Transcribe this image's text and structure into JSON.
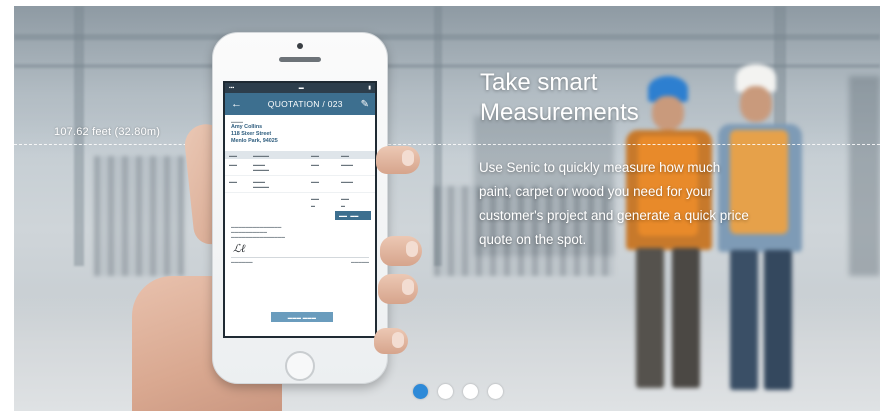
{
  "slide": {
    "measurement_label": "107.62 feet (32.80m)",
    "headline_line1": "Take smart",
    "headline_line2": "Measurements",
    "body_line1": "Use Senic to quickly measure how much",
    "body_line2": "paint, carpet or wood you need for your",
    "body_line3": "customer's project and generate a quick price",
    "body_line4": "quote on the spot."
  },
  "phone": {
    "appbar": {
      "back_icon": "arrow-left-icon",
      "title": "QUOTATION / 023",
      "edit_icon": "pencil-icon"
    },
    "customer": {
      "name": "Amy Collins",
      "street": "118 Sixer Street",
      "city": "Menlo Park, 94025"
    }
  },
  "pagination": {
    "active_index": 0,
    "count": 4,
    "active_color": "#2e8ad8"
  }
}
